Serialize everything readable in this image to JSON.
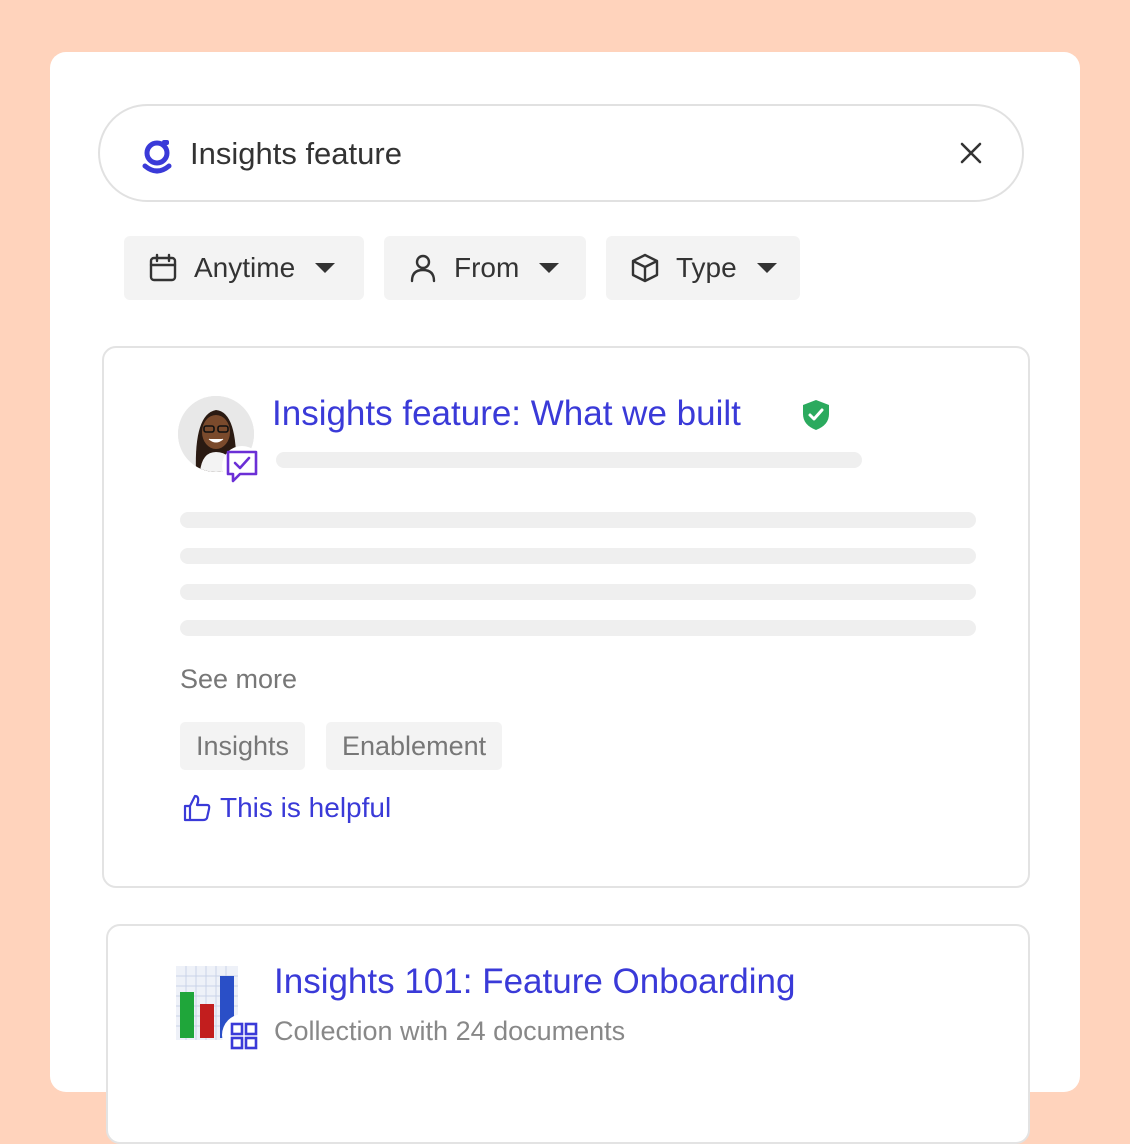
{
  "search": {
    "query": "Insights feature",
    "logo_icon": "glean-logo-icon",
    "close_icon": "close-icon"
  },
  "filters": [
    {
      "label": "Anytime",
      "icon": "calendar-icon"
    },
    {
      "label": "From",
      "icon": "person-icon"
    },
    {
      "label": "Type",
      "icon": "cube-icon"
    }
  ],
  "results": [
    {
      "title": "Insights feature: What we built",
      "verified_icon": "verified-shield-icon",
      "source_icon": "chat-check-icon",
      "see_more": "See more",
      "tags": [
        "Insights",
        "Enablement"
      ],
      "helpful_label": "This is helpful"
    },
    {
      "title": "Insights 101: Feature Onboarding",
      "subtitle": "Collection with 24 documents",
      "source_icon": "collection-grid-icon"
    }
  ],
  "colors": {
    "background": "#FFD3BC",
    "accent": "#3A3AD8",
    "verified": "#2BAA5E"
  }
}
